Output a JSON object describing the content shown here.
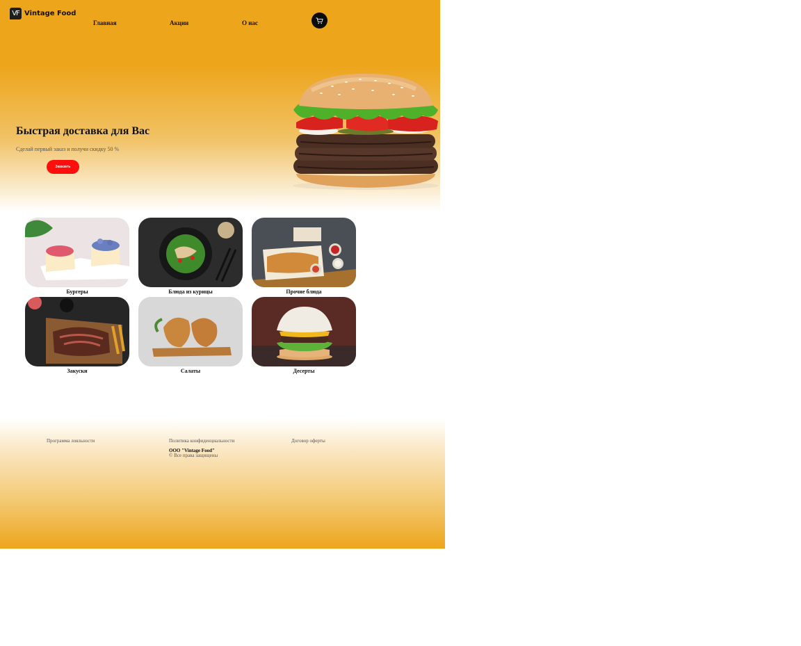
{
  "header": {
    "logo_badge": "VF",
    "logo_text": "Vintage Food",
    "nav": [
      "Главная",
      "Акции",
      "О нас"
    ]
  },
  "hero": {
    "title": "Быстрая доставка для Вас",
    "subtitle": "Сделай первый заказ и получи скидку 50 %",
    "order_button": "Заказать"
  },
  "categories": [
    "Бургеры",
    "Блюда из курицы",
    "Прочие блюда",
    "Закуски",
    "Салаты",
    "Десерты"
  ],
  "footer": {
    "links": [
      "Программа лояльности",
      "Политика конфиденциальности",
      "Договор оферты"
    ],
    "company": "ООО \"Vintage Food\"",
    "rights": "© Все права защищены"
  },
  "colors": {
    "accent": "#eda51c",
    "button_red": "#ff0e0e",
    "dark": "#0b0b0b"
  }
}
